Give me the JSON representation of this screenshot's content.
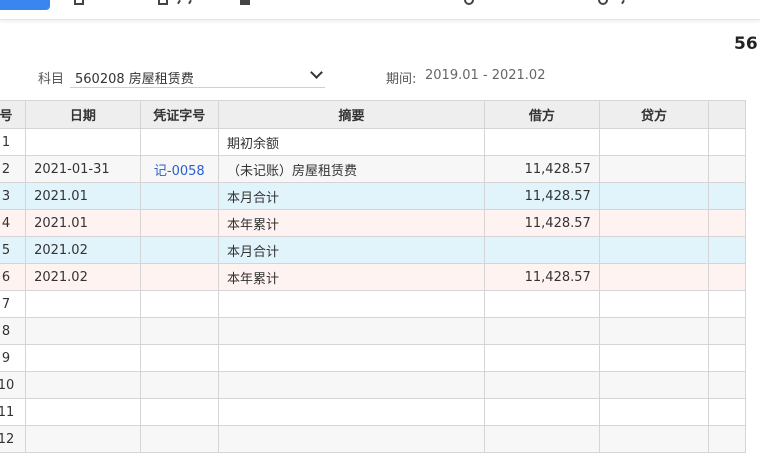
{
  "page": {
    "title": "56"
  },
  "toolbar": {
    "icons": [
      "primary-button",
      "document-icon",
      "edit-icon",
      "save-icon",
      "refresh-icon",
      "settings-icon"
    ]
  },
  "filters": {
    "subject_label": "科目",
    "subject_value": "560208 房屋租赁费",
    "period_label": "期间:",
    "period_value": "2019.01 - 2021.02"
  },
  "table": {
    "headers": {
      "num": "号",
      "date": "日期",
      "voucher": "凭证字号",
      "summary": "摘要",
      "debit": "借方",
      "credit": "贷方"
    },
    "rows": [
      {
        "num": "1",
        "date": "",
        "voucher": "",
        "summary": "期初余额",
        "debit": "",
        "credit": ""
      },
      {
        "num": "2",
        "date": "2021-01-31",
        "voucher": "记-0058",
        "summary": "（未记账）房屋租赁费",
        "debit": "11,428.57",
        "credit": ""
      },
      {
        "num": "3",
        "date": "2021.01",
        "voucher": "",
        "summary": "本月合计",
        "debit": "11,428.57",
        "credit": ""
      },
      {
        "num": "4",
        "date": "2021.01",
        "voucher": "",
        "summary": "本年累计",
        "debit": "11,428.57",
        "credit": ""
      },
      {
        "num": "5",
        "date": "2021.02",
        "voucher": "",
        "summary": "本月合计",
        "debit": "",
        "credit": ""
      },
      {
        "num": "6",
        "date": "2021.02",
        "voucher": "",
        "summary": "本年累计",
        "debit": "11,428.57",
        "credit": ""
      },
      {
        "num": "7",
        "date": "",
        "voucher": "",
        "summary": "",
        "debit": "",
        "credit": ""
      },
      {
        "num": "8",
        "date": "",
        "voucher": "",
        "summary": "",
        "debit": "",
        "credit": ""
      },
      {
        "num": "9",
        "date": "",
        "voucher": "",
        "summary": "",
        "debit": "",
        "credit": ""
      },
      {
        "num": "10",
        "date": "",
        "voucher": "",
        "summary": "",
        "debit": "",
        "credit": ""
      },
      {
        "num": "11",
        "date": "",
        "voucher": "",
        "summary": "",
        "debit": "",
        "credit": ""
      },
      {
        "num": "12",
        "date": "",
        "voucher": "",
        "summary": "",
        "debit": "",
        "credit": ""
      }
    ]
  },
  "colors": {
    "accent": "#3a86f0",
    "row_blue": "#e2f4fb",
    "row_pink": "#fff3f2",
    "link": "#2a5fd0"
  }
}
